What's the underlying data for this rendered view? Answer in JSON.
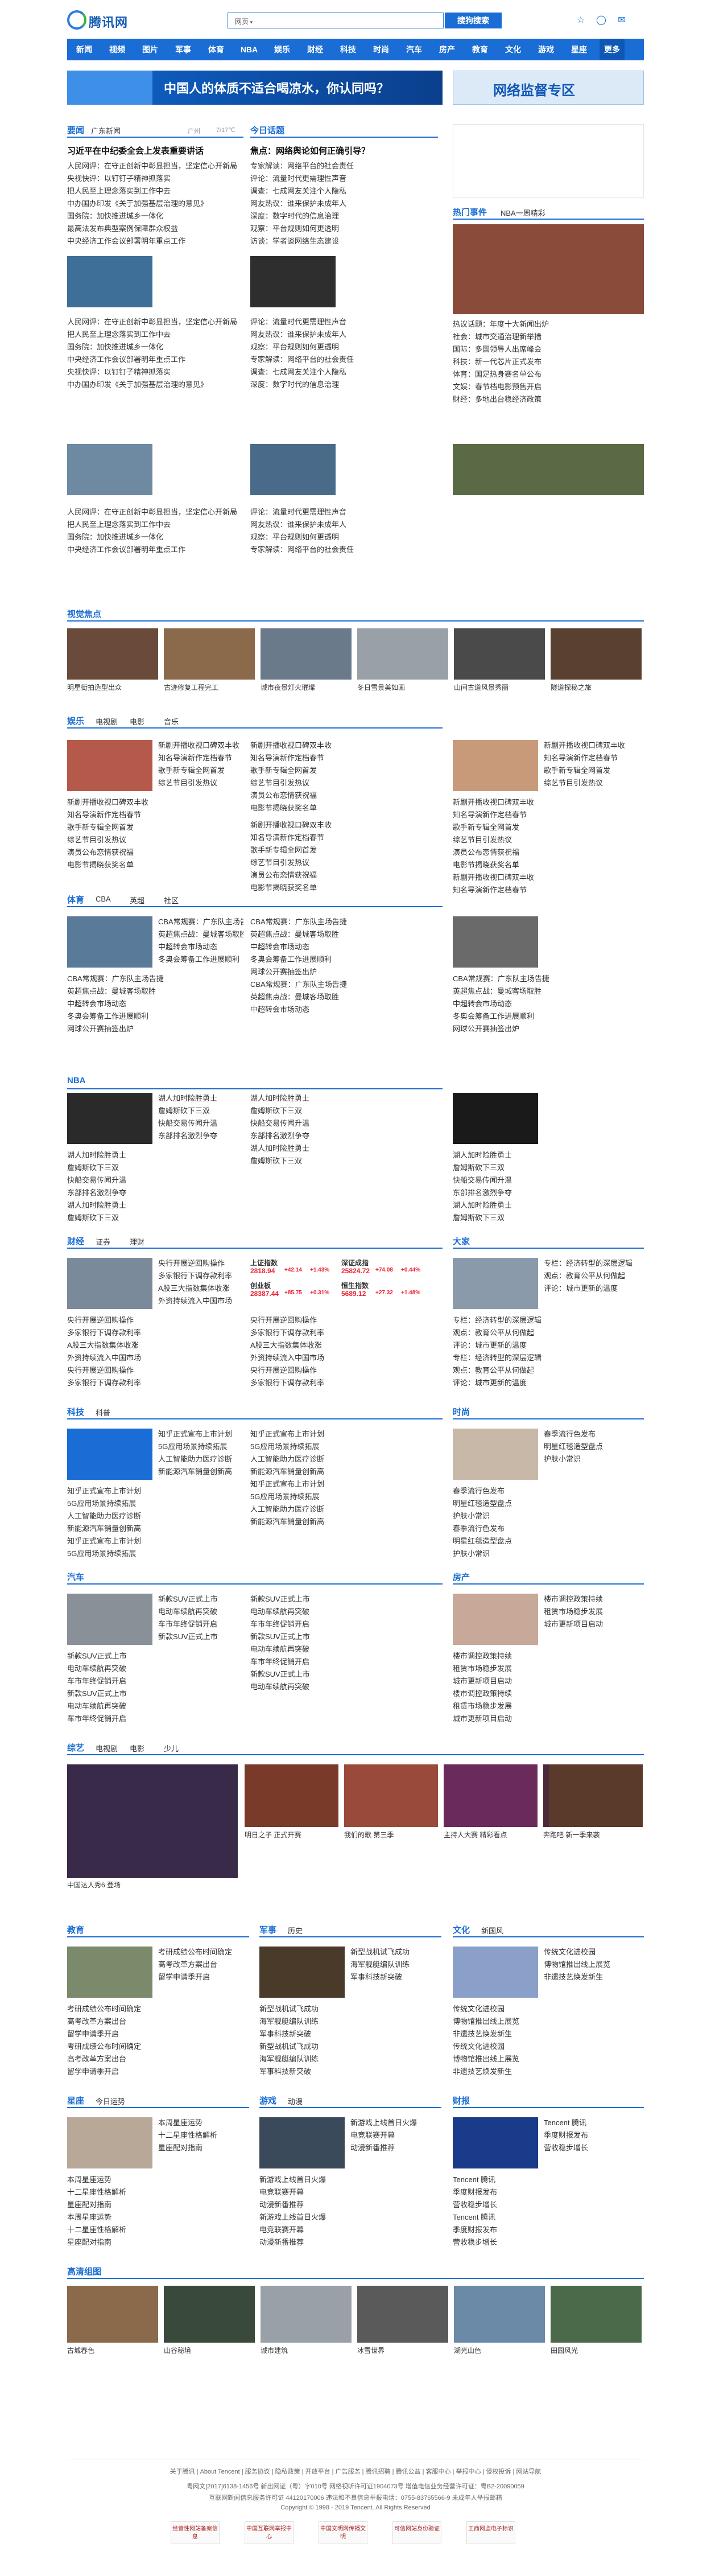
{
  "header": {
    "logo": "腾讯网",
    "search_select": "网页",
    "search_button": "搜狗搜索",
    "icons": [
      "star-icon",
      "user-icon",
      "mail-icon"
    ]
  },
  "nav": [
    "新闻",
    "视频",
    "图片",
    "军事",
    "体育",
    "NBA",
    "娱乐",
    "财经",
    "科技",
    "时尚",
    "汽车",
    "房产",
    "教育",
    "文化",
    "游戏",
    "星座",
    "更多"
  ],
  "banner": {
    "left": "中国人的体质不适合喝凉水，你认同吗？",
    "right": "网络监督专区"
  },
  "sections": {
    "yaowen": {
      "title": "要闻",
      "sub": "广东新闻",
      "city": "广州",
      "temp": "7/17℃",
      "headline": "习近平在中纪委全会上发表重要讲话",
      "items": [
        "人民网评：在守正创新中彰显担当，坚定信心开新局",
        "央视快评：以钉钉子精神抓落实",
        "把人民至上理念落实到工作中去",
        "中办国办印发《关于加强基层治理的意见》",
        "国务院：加快推进城乡一体化",
        "最高法发布典型案例保障群众权益",
        "中央经济工作会议部署明年重点工作"
      ]
    },
    "jinri": {
      "title": "今日话题",
      "headline": "焦点：网络舆论如何正确引导？",
      "items": [
        "专家解读：网络平台的社会责任",
        "评论：流量时代更需理性声音",
        "调查：七成网友关注个人隐私",
        "网友热议：谁来保护未成年人",
        "深度：数字时代的信息治理",
        "观察：平台规则如何更透明",
        "访谈：学者谈网络生态建设"
      ]
    },
    "hotevent": {
      "title": "热门事件",
      "sub": "NBA一周精彩",
      "items": [
        "热议话题：年度十大新闻出炉",
        "社会：城市交通治理新举措",
        "国际：多国领导人出席峰会",
        "科技：新一代芯片正式发布",
        "体育：国足热身赛名单公布",
        "文娱：春节档电影预售开启",
        "财经：多地出台稳经济政策"
      ]
    },
    "pics": {
      "title": "视觉焦点",
      "captions": [
        "明星街拍造型出众",
        "古迹修复工程完工",
        "城市夜景灯火璀璨",
        "冬日雪景美如画",
        "山间古道风景秀丽",
        "隧道探秘之旅"
      ]
    },
    "ent": {
      "title": "娱乐",
      "tabs": [
        "电视剧",
        "电影",
        "音乐"
      ],
      "items": [
        "新剧开播收视口碑双丰收",
        "知名导演新作定档春节",
        "歌手新专辑全网首发",
        "综艺节目引发热议",
        "演员公布恋情获祝福",
        "电影节揭晓获奖名单"
      ]
    },
    "sports": {
      "title": "体育",
      "tabs": [
        "CBA",
        "英超",
        "社区"
      ],
      "items": [
        "CBA常规赛：广东队主场告捷",
        "英超焦点战：曼城客场取胜",
        "中超转会市场动态",
        "冬奥会筹备工作进展顺利",
        "网球公开赛抽签出炉"
      ]
    },
    "nba": {
      "title": "NBA",
      "items": [
        "湖人加时险胜勇士",
        "詹姆斯砍下三双",
        "快船交易传闻升温",
        "东部排名激烈争夺"
      ]
    },
    "finance": {
      "title": "财经",
      "tabs": [
        "证券",
        "理财"
      ],
      "stocks": [
        {
          "name": "上证指数",
          "value": "2818.94",
          "chg": "+42.14",
          "pct": "+1.43%"
        },
        {
          "name": "深证成指",
          "value": "25824.72",
          "chg": "+74.08",
          "pct": "+0.44%"
        },
        {
          "name": "创业板",
          "value": "28387.44",
          "chg": "+85.75",
          "pct": "+0.31%"
        },
        {
          "name": "恒生指数",
          "value": "5689.12",
          "chg": "+27.32",
          "pct": "+1.48%"
        }
      ],
      "items": [
        "央行开展逆回购操作",
        "多家银行下调存款利率",
        "A股三大指数集体收涨",
        "外资持续流入中国市场"
      ]
    },
    "dajia": {
      "title": "大家",
      "items": [
        "专栏：经济转型的深层逻辑",
        "观点：教育公平从何做起",
        "评论：城市更新的温度"
      ]
    },
    "tech": {
      "title": "科技",
      "tabs": [
        "科普"
      ],
      "items": [
        "知乎正式宣布上市计划",
        "5G应用场景持续拓展",
        "人工智能助力医疗诊断",
        "新能源汽车销量创新高"
      ]
    },
    "fashion": {
      "title": "时尚",
      "items": [
        "春季流行色发布",
        "明星红毯造型盘点",
        "护肤小常识"
      ]
    },
    "auto": {
      "title": "汽车",
      "items": [
        "新款SUV正式上市",
        "电动车续航再突破",
        "车市年终促销开启"
      ]
    },
    "house": {
      "title": "房产",
      "items": [
        "楼市调控政策持续",
        "租赁市场稳步发展",
        "城市更新项目启动"
      ]
    },
    "video": {
      "title": "综艺",
      "tabs": [
        "电视剧",
        "电影",
        "少儿"
      ],
      "items": [
        "中国达人秀6 登场",
        "明日之子 正式开赛",
        "我们的歌 第三季",
        "主持人大赛 精彩看点",
        "奔跑吧 新一季来袭"
      ]
    },
    "edu": {
      "title": "教育",
      "items": [
        "考研成绩公布时间确定",
        "高考改革方案出台",
        "留学申请季开启"
      ]
    },
    "mil": {
      "title": "军事",
      "tabs": [
        "历史"
      ],
      "items": [
        "新型战机试飞成功",
        "海军舰艇编队训练",
        "军事科技新突破"
      ]
    },
    "culture": {
      "title": "文化",
      "tabs": [
        "新国风"
      ],
      "items": [
        "传统文化进校园",
        "博物馆推出线上展览",
        "非遗技艺焕发新生"
      ]
    },
    "star": {
      "title": "星座",
      "tabs": [
        "今日运势"
      ],
      "items": [
        "本周星座运势",
        "十二星座性格解析",
        "星座配对指南"
      ]
    },
    "game": {
      "title": "游戏",
      "tabs": [
        "动漫"
      ],
      "items": [
        "新游戏上线首日火爆",
        "电竞联赛开幕",
        "动漫新番推荐"
      ]
    },
    "fin2": {
      "title": "财报",
      "items": [
        "Tencent 腾讯",
        "季度财报发布",
        "营收稳步增长"
      ]
    },
    "gallery": {
      "title": "高清组图",
      "captions": [
        "古城春色",
        "山谷秘境",
        "城市建筑",
        "冰雪世界",
        "湖光山色",
        "田园风光"
      ]
    }
  },
  "footer": {
    "links": "关于腾讯 | About Tencent | 服务协议 | 隐私政策 | 开放平台 | 广告服务 | 腾讯招聘 | 腾讯公益 | 客服中心 | 举报中心 | 侵权投诉 | 网站导航",
    "lines": [
      "粤网文[2017]6138-1456号  新出网证（粤）字010号  网络视听许可证1904073号  增值电信业务经营许可证：粤B2-20090059",
      "互联网新闻信息服务许可证 44120170006  违法和不良信息举报电话：0755-83765566-9  未成年人举报邮箱",
      "Copyright © 1998 - 2019 Tencent. All Rights Reserved"
    ],
    "badges": [
      "经营性网站备案信息",
      "中国互联网举报中心",
      "中国文明网传播文明",
      "可信网站身份验证",
      "工商网监电子标识"
    ]
  }
}
